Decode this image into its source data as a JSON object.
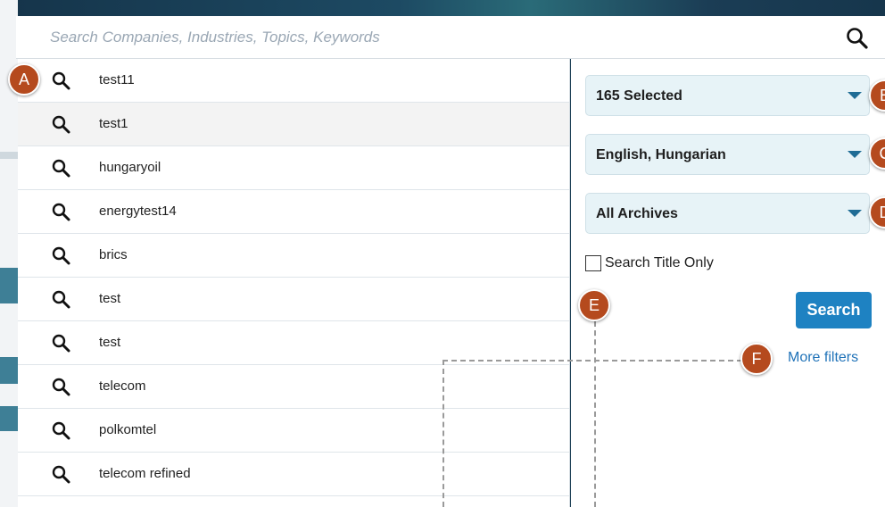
{
  "search": {
    "placeholder": "Search Companies, Industries, Topics, Keywords",
    "value": ""
  },
  "suggestions": [
    {
      "label": "test11",
      "highlighted": false
    },
    {
      "label": "test1",
      "highlighted": true
    },
    {
      "label": "hungaryoil",
      "highlighted": false
    },
    {
      "label": "energytest14",
      "highlighted": false
    },
    {
      "label": "brics",
      "highlighted": false
    },
    {
      "label": "test",
      "highlighted": false
    },
    {
      "label": "test",
      "highlighted": false
    },
    {
      "label": "telecom",
      "highlighted": false
    },
    {
      "label": "polkomtel",
      "highlighted": false
    },
    {
      "label": "telecom refined",
      "highlighted": false
    }
  ],
  "filters": {
    "sources": "165 Selected",
    "languages": "English, Hungarian",
    "archives": "All Archives",
    "title_only_label": "Search Title Only",
    "title_only_checked": false,
    "search_button": "Search",
    "more_filters": "More filters"
  },
  "annotations": {
    "a": "A",
    "b": "B",
    "c": "C",
    "d": "D",
    "e": "E",
    "f": "F"
  },
  "colors": {
    "accent": "#1e82c2",
    "dropdown_bg": "#e7f3f7",
    "badge": "#b54a1e",
    "link": "#1f72b8"
  },
  "icons": {
    "search": "magnifier-icon",
    "dropdown": "caret-down-icon"
  }
}
